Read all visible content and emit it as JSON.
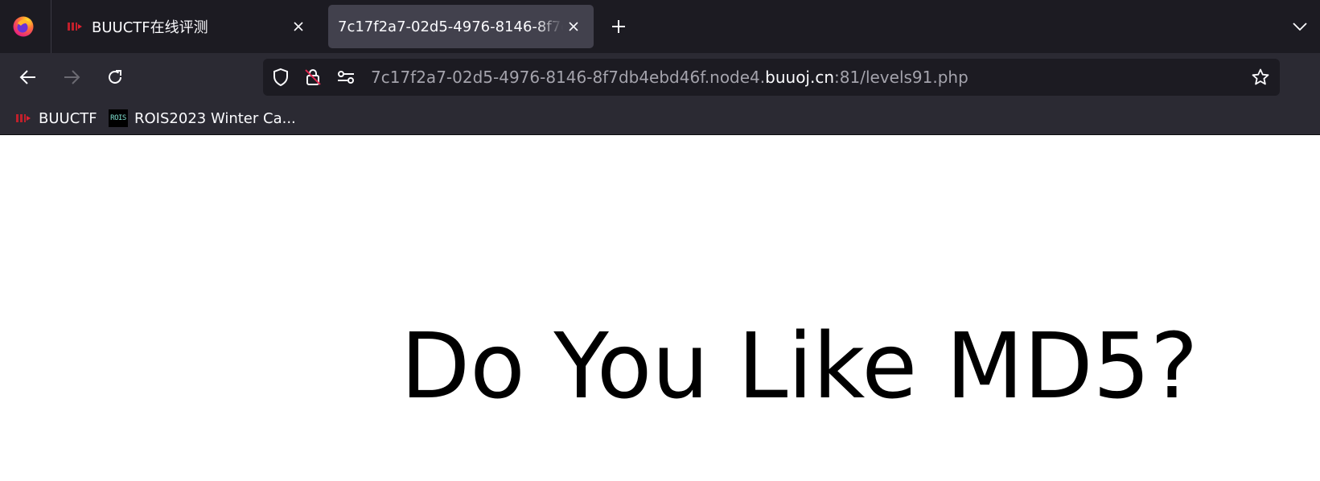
{
  "browser": {
    "tabs": [
      {
        "title": "BUUCTF在线评测",
        "favicon": "buuctf-favicon",
        "active": false
      },
      {
        "title": "7c17f2a7-02d5-4976-8146-8f7db4ebd46f",
        "favicon": "none",
        "active": true
      }
    ],
    "icons": {
      "logo": "firefox-icon",
      "close": "close-icon",
      "new_tab": "plus-icon",
      "tab_list": "chevron-down-icon",
      "back": "arrow-left-icon",
      "forward": "arrow-right-icon",
      "reload": "reload-icon",
      "tracking": "shield-icon",
      "insecure": "lock-slash-icon",
      "permissions": "sliders-icon",
      "bookmark": "star-icon"
    },
    "url": {
      "prefix": "7c17f2a7-02d5-4976-8146-8f7db4ebd46f.node4.",
      "host": "buuoj.cn",
      "suffix": ":81/levels91.php"
    },
    "bookmarks": [
      {
        "label": "BUUCTF",
        "favicon": "buuctf-favicon"
      },
      {
        "label": "ROIS2023 Winter Ca...",
        "favicon": "rois-favicon",
        "favicon_text": "ROIS"
      }
    ]
  },
  "page": {
    "heading": "Do You Like MD5?"
  },
  "colors": {
    "tabstrip_bg": "#1c1b22",
    "toolbar_bg": "#2b2a33",
    "active_tab_bg": "#42414d",
    "urlbar_bg": "#1c1b22",
    "text_primary": "#fbfbfe",
    "text_dim": "#a4a3ac",
    "page_bg": "#ffffff"
  }
}
